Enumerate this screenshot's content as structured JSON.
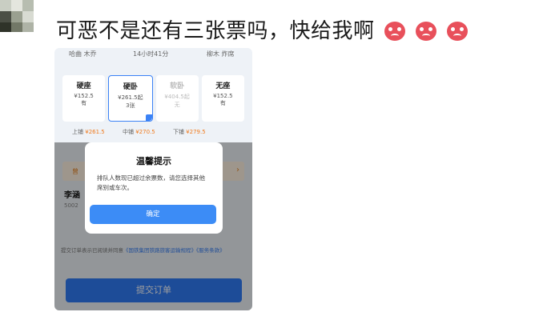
{
  "post": {
    "text": "可恶不是还有三张票吗，快给我啊",
    "emojis": [
      "angry-face-icon",
      "angry-face-icon",
      "angry-face-icon"
    ]
  },
  "screenshot": {
    "top_info": {
      "left": "哈曲 木乔",
      "center": "14小时41分",
      "right": "柳木 炸席"
    },
    "seats": [
      {
        "name": "硬座",
        "price": "¥152.5",
        "availability": "有"
      },
      {
        "name": "硬卧",
        "price": "¥261.5起",
        "availability": "3张"
      },
      {
        "name": "软卧",
        "price": "¥404.5起",
        "availability": "无"
      },
      {
        "name": "无座",
        "price": "¥152.5",
        "availability": "有"
      }
    ],
    "berths": [
      {
        "label": "上铺",
        "price": "¥261.5"
      },
      {
        "label": "中铺",
        "price": "¥270.5"
      },
      {
        "label": "下铺",
        "price": "¥279.5"
      }
    ],
    "orange_bar": "曾",
    "passenger_name": "李涵",
    "passenger_sub": "5002",
    "submit_note": "提交订单表示已阅读并同意",
    "submit_note_link": "《国铁集团铁路旅客运输规程》《服务条款》",
    "submit_label": "提交订单",
    "dialog": {
      "title": "温馨提示",
      "body": "排队人数现已超过余票数，请您选择其他席别或车次。",
      "ok_label": "确定"
    }
  },
  "colors": {
    "accent": "#3c8cf6",
    "price_orange": "#f07b1f",
    "emoji_red": "#e8505b"
  }
}
